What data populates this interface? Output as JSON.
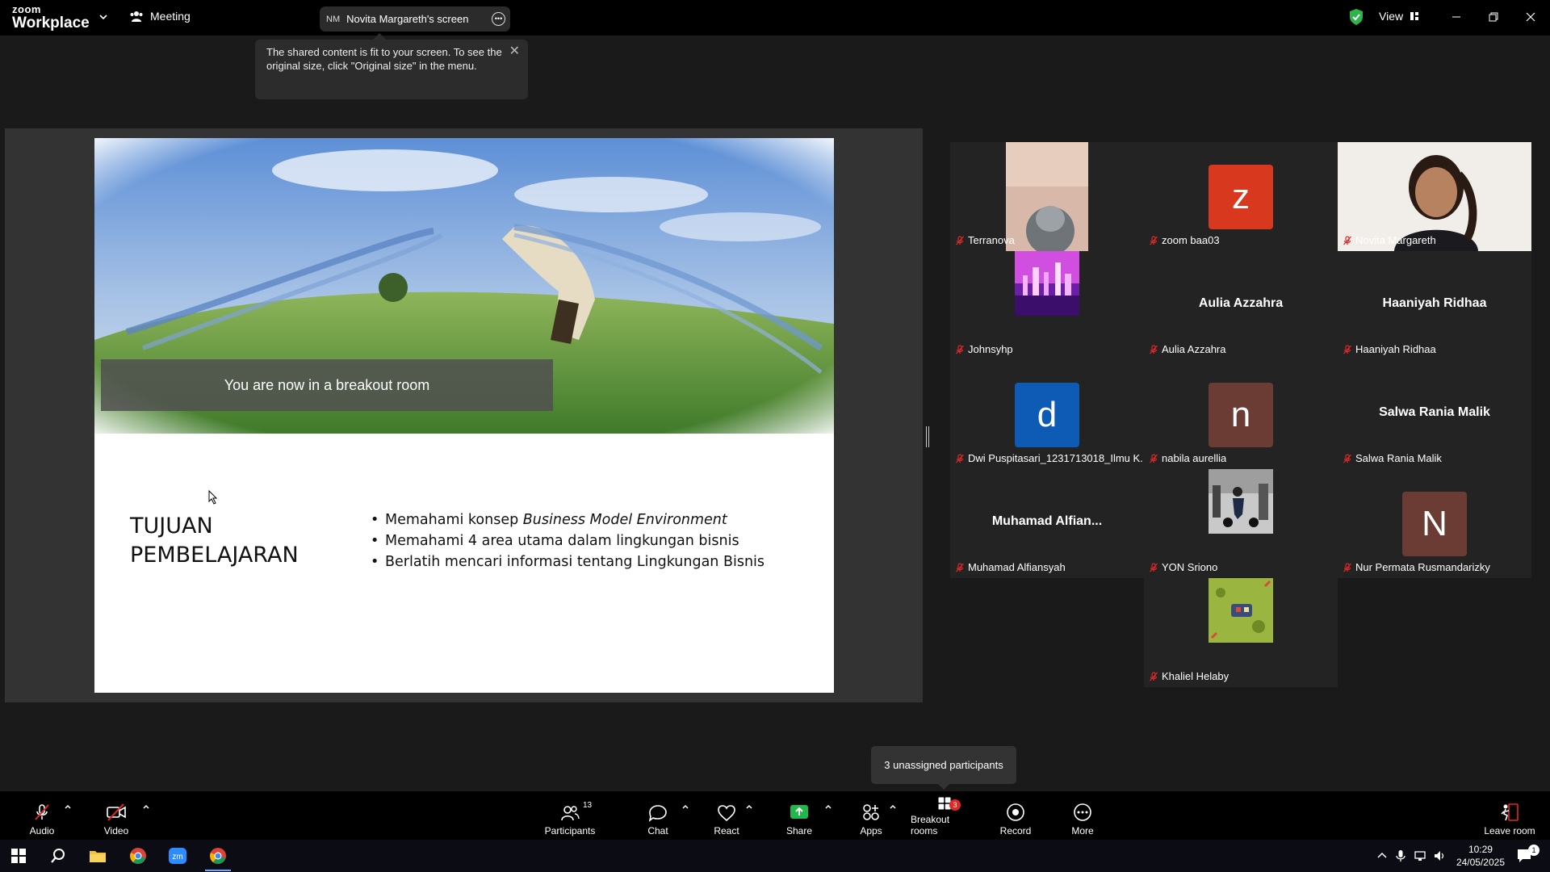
{
  "app": {
    "brand_line1": "zoom",
    "brand_line2": "Workplace",
    "meeting_label": "Meeting"
  },
  "screen_share": {
    "initials": "NM",
    "label": "Novita Margareth's screen"
  },
  "tooltip": {
    "text": "The shared content is fit to your screen. To see the original size, click \"Original size\" in the menu."
  },
  "view": {
    "label": "View"
  },
  "slide": {
    "breakout_message": "You are now in a breakout room",
    "title": "TUJUAN\nPEMBELAJARAN",
    "bullets": [
      {
        "prefix": "Memahami konsep ",
        "italic": "Business Model Environment"
      },
      {
        "prefix": "Memahami 4 area utama dalam lingkungan bisnis",
        "italic": ""
      },
      {
        "prefix": "Berlatih mencari informasi tentang Lingkungan Bisnis",
        "italic": ""
      }
    ]
  },
  "participants": [
    {
      "name": "Terranova",
      "type": "video"
    },
    {
      "name": "zoom baa03",
      "type": "avatar",
      "letter": "z",
      "color": "#d8391e"
    },
    {
      "name": "Novita Margareth",
      "type": "video-active"
    },
    {
      "name": "Johnsyhp",
      "type": "image"
    },
    {
      "name": "Aulia Azzahra",
      "type": "name",
      "display": "Aulia Azzahra"
    },
    {
      "name": "Haaniyah Ridhaa",
      "type": "name",
      "display": "Haaniyah Ridhaa"
    },
    {
      "name": "Dwi Puspitasari_1231713018_Ilmu K...",
      "type": "avatar",
      "letter": "d",
      "color": "#0d5bb5"
    },
    {
      "name": "nabila aurellia",
      "type": "avatar",
      "letter": "n",
      "color": "#6b3c34"
    },
    {
      "name": "Salwa Rania Malik",
      "type": "name",
      "display": "Salwa Rania Malik"
    },
    {
      "name": "Muhamad Alfiansyah",
      "type": "name",
      "display": "Muhamad  Alfian..."
    },
    {
      "name": "YON Sriono",
      "type": "image"
    },
    {
      "name": "Nur Permata Rusmandarizky",
      "type": "avatar",
      "letter": "N",
      "color": "#6b3c34"
    },
    {
      "name": "Khaliel Helaby",
      "type": "image"
    }
  ],
  "unassigned": {
    "text": "3 unassigned participants"
  },
  "toolbar": {
    "audio": "Audio",
    "video": "Video",
    "participants": "Participants",
    "participants_count": "13",
    "chat": "Chat",
    "react": "React",
    "share": "Share",
    "apps": "Apps",
    "breakout": "Breakout rooms",
    "breakout_badge": "3",
    "record": "Record",
    "more": "More",
    "leave": "Leave room"
  },
  "taskbar": {
    "time": "10:29",
    "date": "24/05/2025",
    "notif_count": "1"
  },
  "colors": {
    "active_border": "#2fd06c",
    "share_green": "#20b84a",
    "badge_red": "#e02828"
  }
}
